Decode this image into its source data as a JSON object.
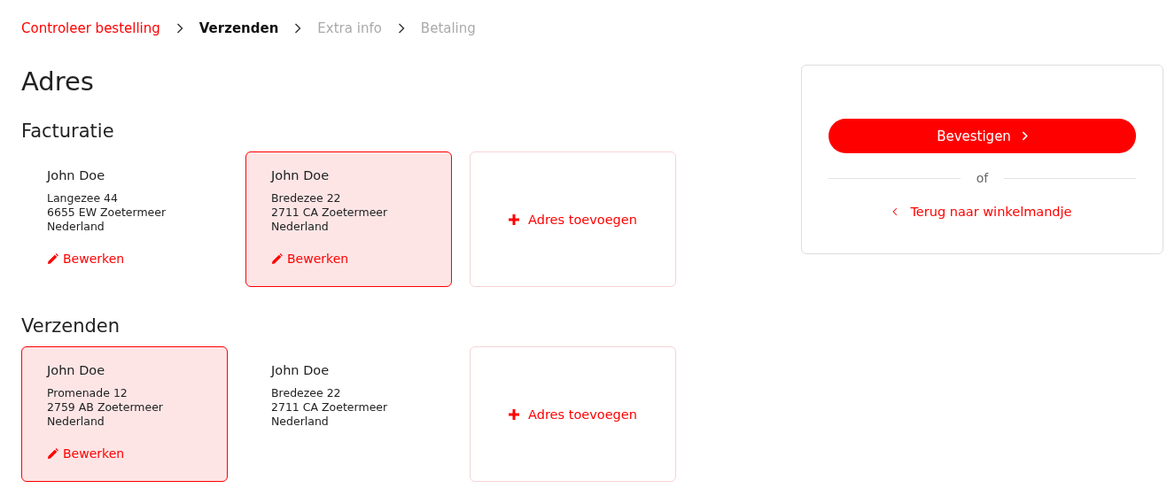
{
  "breadcrumb": [
    {
      "label": "Controleer bestelling",
      "kind": "done"
    },
    {
      "label": "Verzenden",
      "kind": "current"
    },
    {
      "label": "Extra info",
      "kind": "upcoming"
    },
    {
      "label": "Betaling",
      "kind": "upcoming"
    }
  ],
  "title": "Adres",
  "sections": [
    {
      "heading": "Facturatie",
      "cards": [
        {
          "name": "John Doe",
          "lines": [
            "Langezee 44",
            "6655 EW Zoetermeer",
            "Nederland"
          ],
          "edit": "Bewerken",
          "selected": false
        },
        {
          "name": "John Doe",
          "lines": [
            "Bredezee 22",
            "2711 CA Zoetermeer",
            "Nederland"
          ],
          "edit": "Bewerken",
          "selected": true
        }
      ],
      "add": "Adres toevoegen"
    },
    {
      "heading": "Verzenden",
      "cards": [
        {
          "name": "John Doe",
          "lines": [
            "Promenade 12",
            "2759 AB Zoetermeer",
            "Nederland"
          ],
          "edit": "Bewerken",
          "selected": true
        },
        {
          "name": "John Doe",
          "lines": [
            "Bredezee 22",
            "2711 CA Zoetermeer",
            "Nederland"
          ],
          "selected": false
        }
      ],
      "add": "Adres toevoegen"
    }
  ],
  "summary": {
    "confirm": "Bevestigen",
    "separator": "of",
    "back": "Terug naar winkelmandje"
  }
}
